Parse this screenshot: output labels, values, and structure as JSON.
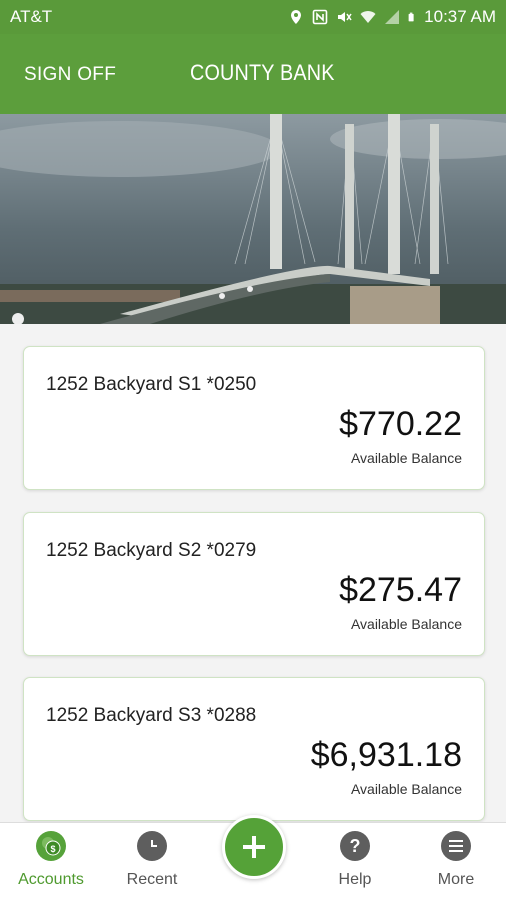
{
  "status_bar": {
    "carrier": "AT&T",
    "time": "10:37 AM",
    "icons": [
      "location-icon",
      "nfc-icon",
      "mute-icon",
      "wifi-icon",
      "signal-icon",
      "battery-icon"
    ]
  },
  "header": {
    "sign_off": "SIGN OFF",
    "title": "COUNTY BANK",
    "color": "#5c9e3c"
  },
  "accounts": [
    {
      "name": "1252 Backyard S1 *0250",
      "amount": "$770.22",
      "caption": "Available Balance"
    },
    {
      "name": "1252 Backyard S2 *0279",
      "amount": "$275.47",
      "caption": "Available Balance"
    },
    {
      "name": "1252 Backyard S3 *0288",
      "amount": "$6,931.18",
      "caption": "Available Balance"
    }
  ],
  "tab_bar": {
    "items": [
      {
        "label": "Accounts",
        "icon": "accounts-icon",
        "active": true
      },
      {
        "label": "Recent",
        "icon": "clock-icon",
        "active": false
      },
      {
        "label": "",
        "icon": "plus-icon",
        "active": false
      },
      {
        "label": "Help",
        "icon": "help-icon",
        "active": false
      },
      {
        "label": "More",
        "icon": "menu-icon",
        "active": false
      }
    ],
    "accent": "#4f9a2f"
  }
}
